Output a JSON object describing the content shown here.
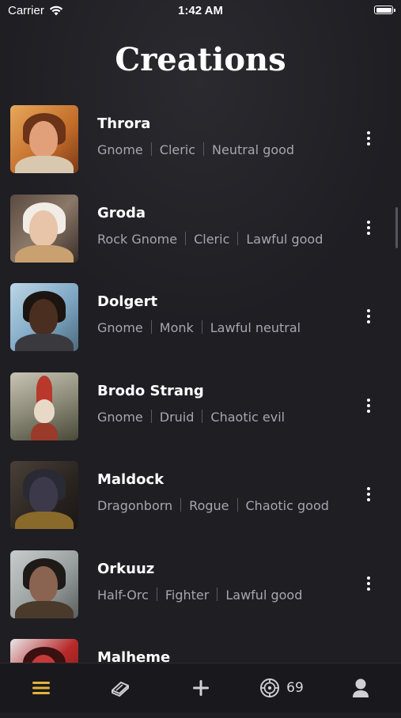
{
  "status_bar": {
    "carrier": "Carrier",
    "time": "1:42 AM"
  },
  "header": {
    "title": "Creations"
  },
  "characters": [
    {
      "name": "Throra",
      "race": "Gnome",
      "class": "Cleric",
      "alignment": "Neutral good"
    },
    {
      "name": "Groda",
      "race": "Rock Gnome",
      "class": "Cleric",
      "alignment": "Lawful good"
    },
    {
      "name": "Dolgert",
      "race": "Gnome",
      "class": "Monk",
      "alignment": "Lawful neutral"
    },
    {
      "name": "Brodo Strang",
      "race": "Gnome",
      "class": "Druid",
      "alignment": "Chaotic evil"
    },
    {
      "name": "Maldock",
      "race": "Dragonborn",
      "class": "Rogue",
      "alignment": "Chaotic good"
    },
    {
      "name": "Orkuuz",
      "race": "Half-Orc",
      "class": "Fighter",
      "alignment": "Lawful good"
    },
    {
      "name": "Malheme"
    }
  ],
  "tab_bar": {
    "tabs": [
      "list-icon",
      "book-icon",
      "plus-icon",
      "dice-icon",
      "profile-icon"
    ],
    "credits": "69",
    "active_color": "#e3b23c",
    "inactive_color": "#cfcfd4"
  }
}
